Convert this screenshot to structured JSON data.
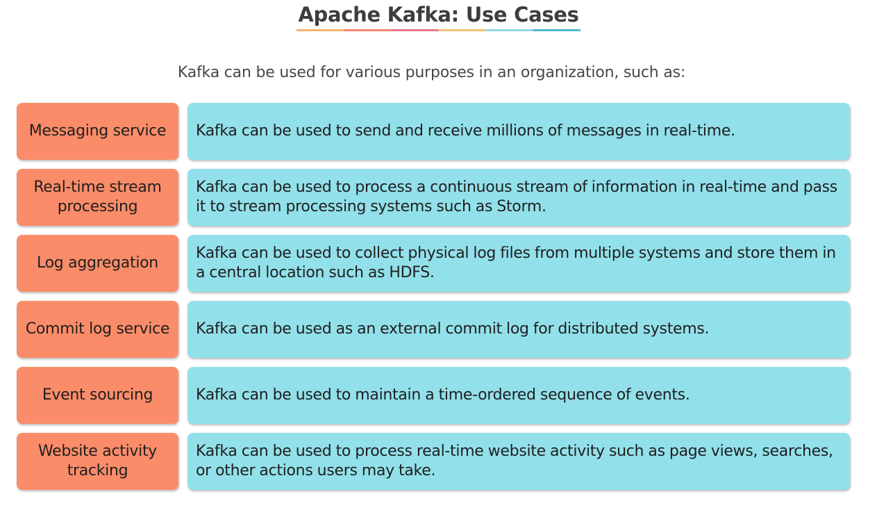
{
  "title": "Apache Kafka: Use Cases",
  "title_underline_colors": [
    "#f7b36e",
    "#f08a6f",
    "#e8748f",
    "#f5c07a",
    "#8ed8e6",
    "#4fb8cf"
  ],
  "subtitle": "Kafka can be used for various purposes in an organization, such as:",
  "colors": {
    "label_bg": "#fb8c69",
    "desc_bg": "#92e0ea"
  },
  "use_cases": [
    {
      "label": "Messaging service",
      "description": "Kafka can be used to send and receive millions of messages in real-time."
    },
    {
      "label": "Real-time stream processing",
      "description": "Kafka can be used to process a continuous stream of information in real-time and pass it to stream processing systems such as Storm."
    },
    {
      "label": "Log aggregation",
      "description": "Kafka can be used to collect physical log files from multiple systems and store them in a central location such as HDFS."
    },
    {
      "label": "Commit log service",
      "description": "Kafka can be used as an external commit log for distributed systems."
    },
    {
      "label": "Event sourcing",
      "description": "Kafka can be used to maintain a time-ordered sequence of events."
    },
    {
      "label": "Website activity tracking",
      "description": "Kafka can be used to process real-time website activity such as page views, searches, or other actions users may take."
    }
  ]
}
